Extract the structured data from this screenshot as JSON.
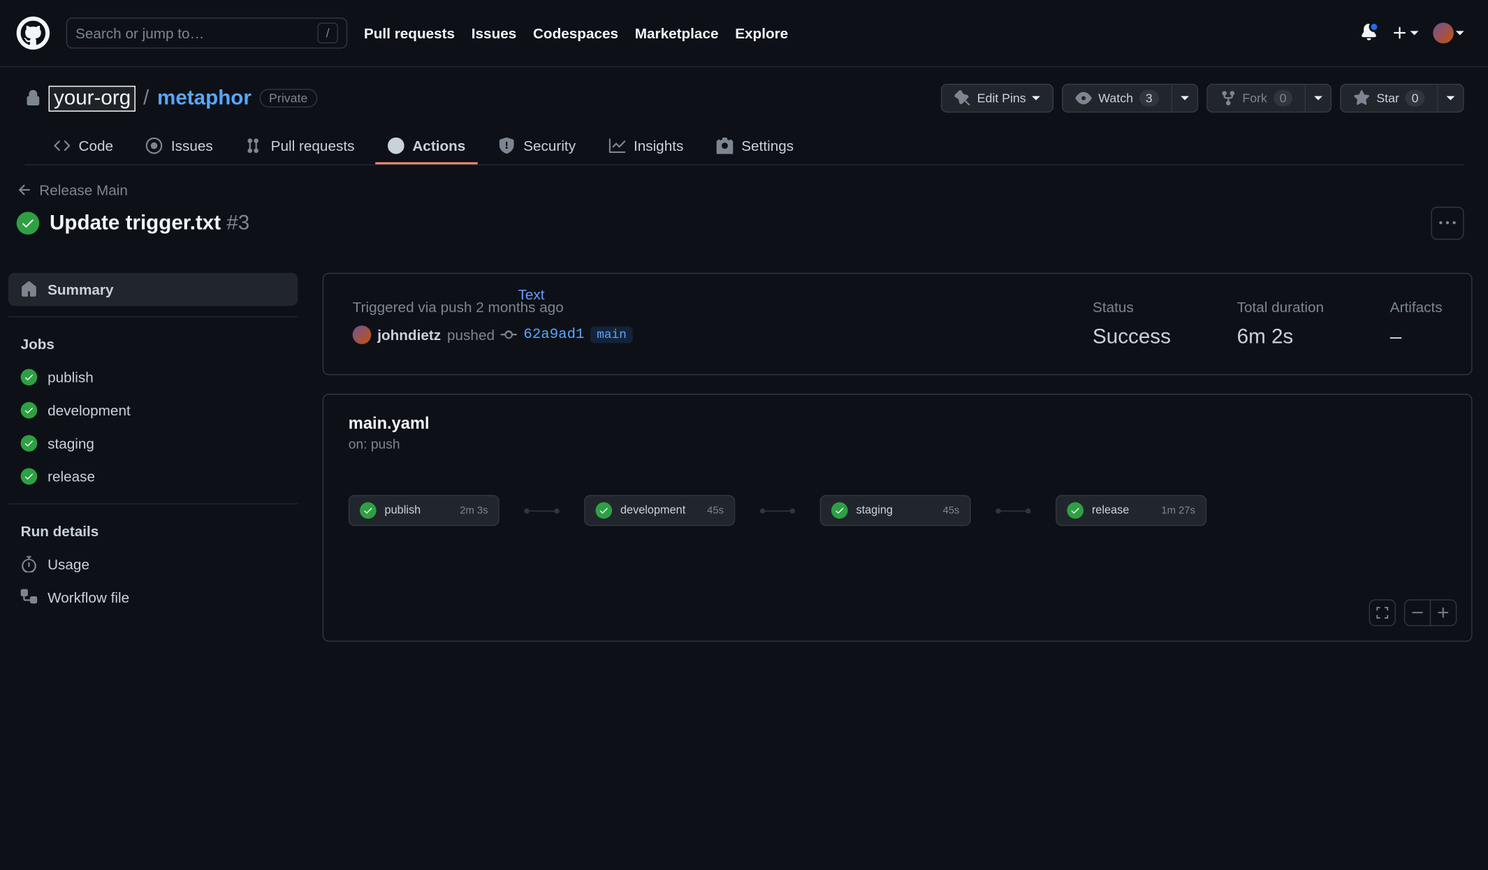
{
  "search": {
    "placeholder": "Search or jump to…",
    "slash": "/"
  },
  "topnav": {
    "pulls": "Pull requests",
    "issues": "Issues",
    "codespaces": "Codespaces",
    "marketplace": "Marketplace",
    "explore": "Explore"
  },
  "repo": {
    "org": "your-org",
    "name": "metaphor",
    "visibility": "Private",
    "pins": "Edit Pins",
    "watch": "Watch",
    "watch_count": "3",
    "fork": "Fork",
    "fork_count": "0",
    "star": "Star",
    "star_count": "0"
  },
  "tabs": {
    "code": "Code",
    "issues": "Issues",
    "pulls": "Pull requests",
    "actions": "Actions",
    "security": "Security",
    "insights": "Insights",
    "settings": "Settings"
  },
  "workflow": {
    "back": "Release Main",
    "title": "Update trigger.txt",
    "number": "#3",
    "float_text": "Text"
  },
  "sidebar": {
    "summary": "Summary",
    "jobs_heading": "Jobs",
    "jobs": [
      {
        "name": "publish"
      },
      {
        "name": "development"
      },
      {
        "name": "staging"
      },
      {
        "name": "release"
      }
    ],
    "details_heading": "Run details",
    "usage": "Usage",
    "workflow_file": "Workflow file"
  },
  "summary": {
    "trigger_line": "Triggered via push 2 months ago",
    "user": "johndietz",
    "action": "pushed",
    "commit": "62a9ad1",
    "branch": "main",
    "status_label": "Status",
    "status_value": "Success",
    "duration_label": "Total duration",
    "duration_value": "6m 2s",
    "artifacts_label": "Artifacts",
    "artifacts_value": "–"
  },
  "graph": {
    "file": "main.yaml",
    "trigger": "on: push",
    "nodes": [
      {
        "name": "publish",
        "duration": "2m 3s"
      },
      {
        "name": "development",
        "duration": "45s"
      },
      {
        "name": "staging",
        "duration": "45s"
      },
      {
        "name": "release",
        "duration": "1m 27s"
      }
    ]
  }
}
